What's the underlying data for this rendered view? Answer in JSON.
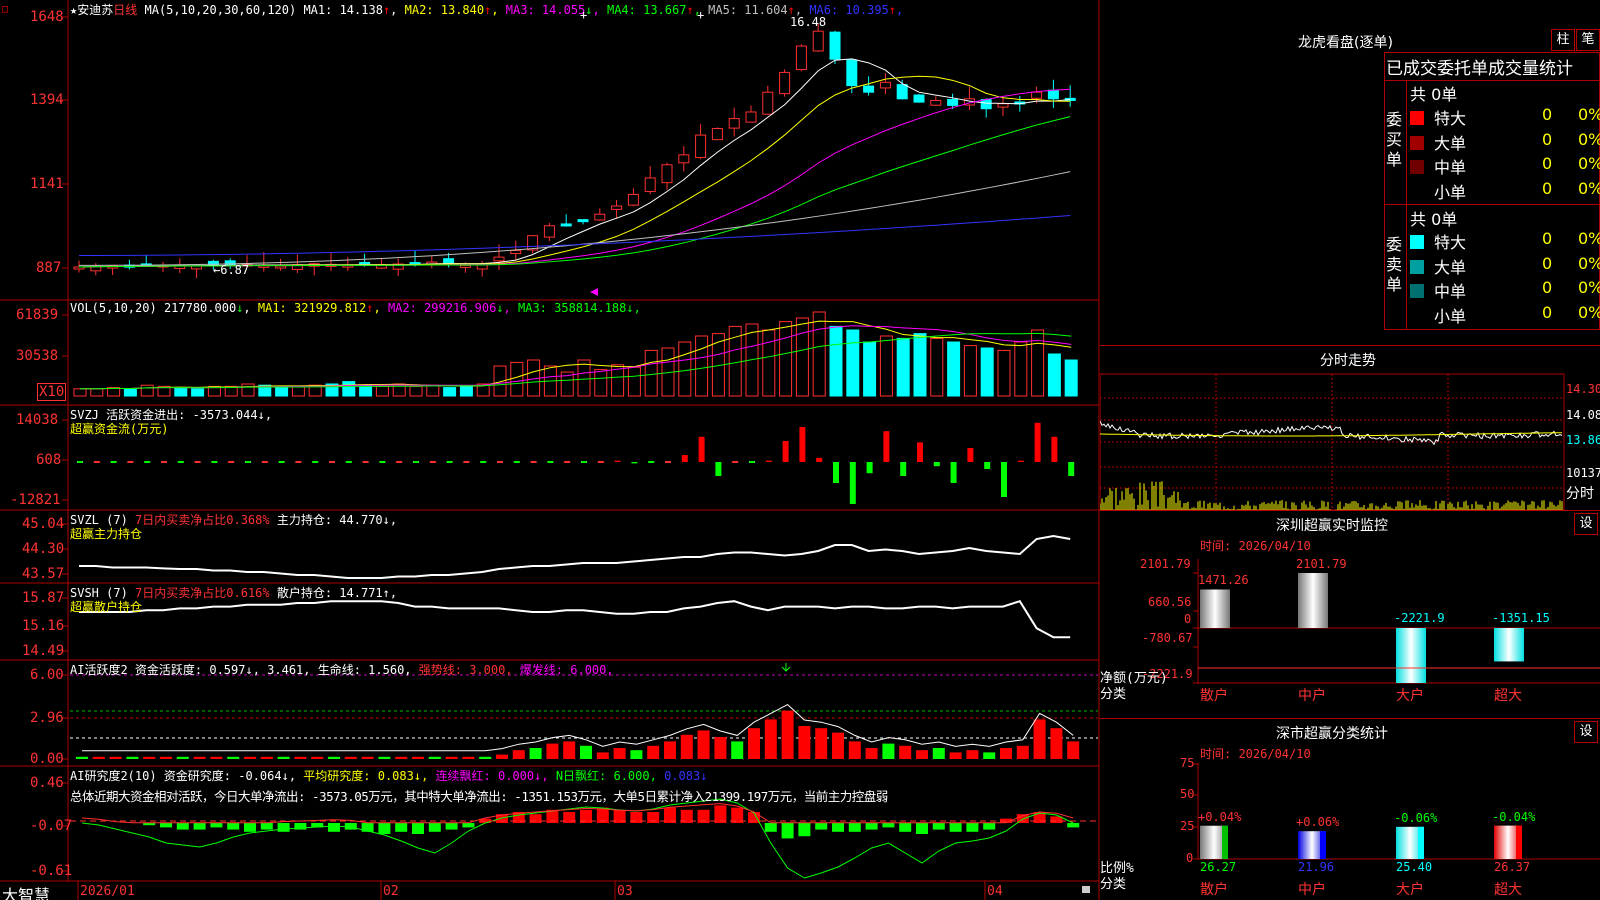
{
  "stock": {
    "star": "★",
    "name": "安迪苏",
    "period": "日线"
  },
  "ma_header": {
    "label": "MA(5,10,20,30,60,120)",
    "items": [
      {
        "name": "MA1:",
        "value": "14.138",
        "arrow": "↑",
        "color": "#ffffff"
      },
      {
        "name": "MA2:",
        "value": "13.840",
        "arrow": "↑",
        "color": "#ffff00"
      },
      {
        "name": "MA3:",
        "value": "14.055",
        "arrow": "↓",
        "color": "#ff00ff"
      },
      {
        "name": "MA4:",
        "value": "13.667",
        "arrow": "↑",
        "color": "#00ff00"
      },
      {
        "name": "MA5:",
        "value": "11.604",
        "arrow": "↑",
        "color": "#c0c0c0"
      },
      {
        "name": "MA6:",
        "value": "10.395",
        "arrow": "↑",
        "color": "#3333ff"
      }
    ]
  },
  "price_axis": [
    "1648",
    "1394",
    "1141",
    "887"
  ],
  "price_marks": {
    "high": "16.48",
    "low": "6.87"
  },
  "vol": {
    "axis": [
      "61839",
      "30538",
      "X10"
    ],
    "header": "VOL(5,10,20)",
    "value": "217780.000",
    "items": [
      {
        "name": "MA1:",
        "value": "321929.812",
        "arrow": "↑",
        "color": "#ffff00"
      },
      {
        "name": "MA2:",
        "value": "299216.906",
        "arrow": "↓",
        "color": "#ff00ff"
      },
      {
        "name": "MA3:",
        "value": "358814.188",
        "arrow": "↓",
        "color": "#00ff00"
      }
    ]
  },
  "svzj": {
    "axis": [
      "14038",
      "608",
      "-12821"
    ],
    "header": "SVZJ  活跃资金进出: -3573.044↓,",
    "sub": "超赢资金流(万元)"
  },
  "svzl": {
    "axis": [
      "45.04",
      "44.30",
      "43.57"
    ],
    "header_a": "SVZL (7)",
    "header_b": "7日内买卖净占比0.368%",
    "header_c": "主力持仓: 44.770↓,",
    "sub": "超赢主力持仓"
  },
  "svsh": {
    "axis": [
      "15.87",
      "15.16",
      "14.49"
    ],
    "header_a": "SVSH (7)",
    "header_b": "7日内买卖净占比0.616%",
    "header_c": "散户持仓: 14.771↑,",
    "sub": "超赢散户持仓"
  },
  "ai_active": {
    "axis": [
      "6.00",
      "2.96",
      "0.00"
    ],
    "h1": "AI活跃度2 资金活跃度: 0.597↓, 3.461, 生命线: 1.560,",
    "h2": "强势线: 3.000,",
    "h3": "爆发线: 6.000,"
  },
  "ai_research": {
    "axis": [
      "0.46",
      "-0.07",
      "-0.61"
    ],
    "h1": "AI研究度2(10) 资金研究度: -0.064↓,",
    "h2": "平均研究度: 0.083↓,",
    "h3": "连续飘红: 0.000↓,",
    "h4": "N日飘红: 6.000,",
    "h5": "0.083↓",
    "summary": "总体近期大资金相对活跃，今日大单净流出: -3573.05万元，其中特大单净流出: -1351.153万元，大单5日累计净入21399.197万元，当前主力控盘弱"
  },
  "x_axis": [
    "2026/01",
    "02",
    "03",
    "04"
  ],
  "brand": "大智慧",
  "dragon": {
    "title": "龙虎看盘(逐单)",
    "btn_bar": "柱",
    "btn_pen": "笔",
    "subtitle": "已成交委托单成交量统计",
    "buy": {
      "side": "委买单",
      "total": "共 0单",
      "rows": [
        {
          "label": "特大",
          "count": "0",
          "pct": "0%",
          "color": "#ff0000"
        },
        {
          "label": "大单",
          "count": "0",
          "pct": "0%",
          "color": "#a00000"
        },
        {
          "label": "中单",
          "count": "0",
          "pct": "0%",
          "color": "#700000"
        },
        {
          "label": "小单",
          "count": "0",
          "pct": "0%",
          "color": ""
        }
      ]
    },
    "sell": {
      "side": "委卖单",
      "total": "共 0单",
      "rows": [
        {
          "label": "特大",
          "count": "0",
          "pct": "0%",
          "color": "#00ffff"
        },
        {
          "label": "大单",
          "count": "0",
          "pct": "0%",
          "color": "#00a0a0"
        },
        {
          "label": "中单",
          "count": "0",
          "pct": "0%",
          "color": "#007070"
        },
        {
          "label": "小单",
          "count": "0",
          "pct": "0%",
          "color": ""
        }
      ]
    }
  },
  "intraday": {
    "title": "分时走势",
    "axis": [
      "14.30",
      "14.08",
      "13.86",
      "10137",
      "分时"
    ]
  },
  "sz_monitor": {
    "title": "深圳超赢实时监控",
    "btn": "设",
    "time": "时间: 2026/04/10",
    "axis": [
      "2101.79",
      "660.56",
      "0",
      "-780.67",
      "-2221.9"
    ],
    "y_label_1": "净额(万元)",
    "y_label_2": "分类",
    "chart_data": {
      "type": "bar",
      "categories": [
        "散户",
        "中户",
        "大户",
        "超大"
      ],
      "values": [
        1471.26,
        2101.79,
        -2221.9,
        -1351.15
      ],
      "labels": [
        "1471.26",
        "2101.79",
        "-2221.9",
        "-1351.15"
      ],
      "ylim": [
        -2221.9,
        2101.79
      ]
    }
  },
  "sz_class": {
    "title": "深市超赢分类统计",
    "btn": "设",
    "time": "时间: 2026/04/10",
    "axis": [
      "75",
      "50",
      "25",
      "0"
    ],
    "y_label_1": "比例%",
    "y_label_2": "分类",
    "chart_data": {
      "type": "bar",
      "categories": [
        "散户",
        "中户",
        "大户",
        "超大"
      ],
      "values": [
        26.27,
        21.96,
        25.4,
        26.37
      ],
      "changes": [
        "+0.04%",
        "+0.06%",
        "-0.06%",
        "-0.04%"
      ],
      "value_labels": [
        "26.27",
        "21.96",
        "25.40",
        "26.37"
      ],
      "ylim": [
        0,
        75
      ]
    }
  },
  "colors": {
    "up": "#ff0000",
    "down": "#00ffff",
    "border": "#b00000",
    "axis_text": "#ff3333"
  }
}
